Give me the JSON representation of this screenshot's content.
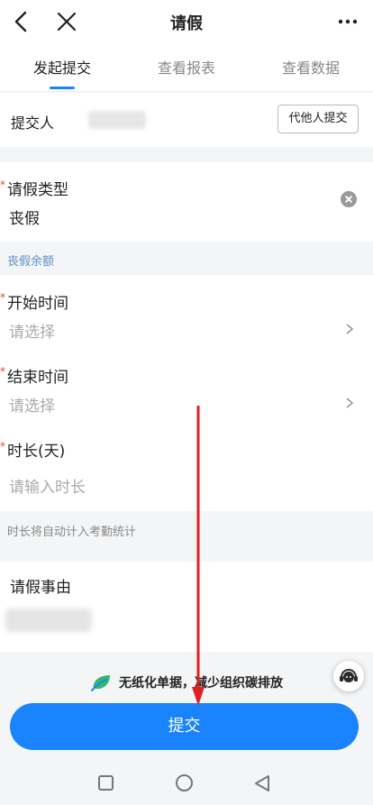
{
  "header": {
    "title": "请假"
  },
  "tabs": [
    {
      "label": "发起提交"
    },
    {
      "label": "查看报表"
    },
    {
      "label": "查看数据"
    }
  ],
  "submitter": {
    "label": "提交人",
    "proxy_button": "代他人提交"
  },
  "leave_type": {
    "label": "请假类型",
    "value": "丧假"
  },
  "balance_label": "丧假余额",
  "start_time": {
    "label": "开始时间",
    "placeholder": "请选择"
  },
  "end_time": {
    "label": "结束时间",
    "placeholder": "请选择"
  },
  "duration": {
    "label": "时长(天)",
    "placeholder": "请输入时长"
  },
  "duration_note": "时长将自动计入考勤统计",
  "reason": {
    "label": "请假事由"
  },
  "eco_text": "无纸化单据，减少组织碳排放",
  "submit_label": "提交",
  "colors": {
    "accent": "#1a84ff",
    "required": "#e24a3b",
    "annotation_arrow": "#e02020"
  }
}
